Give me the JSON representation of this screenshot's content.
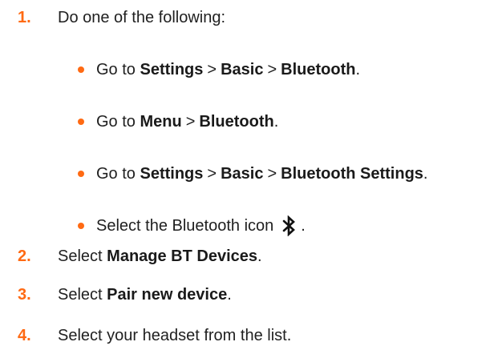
{
  "accent_color": "#ff6a13",
  "steps": [
    {
      "number": "1.",
      "text": "Do one of the following:"
    },
    {
      "number": "2.",
      "prefix": "Select",
      "bold": "Manage BT Devices",
      "suffix": "."
    },
    {
      "number": "3.",
      "prefix": "Select",
      "bold": "Pair new device",
      "suffix": "."
    },
    {
      "number": "4.",
      "text": "Select your headset from the list."
    }
  ],
  "bullets": [
    {
      "prefix": "Go to",
      "path": [
        "Settings",
        "Basic",
        "Bluetooth"
      ],
      "sep": ">",
      "suffix": "."
    },
    {
      "prefix": "Go to",
      "path": [
        "Menu",
        "Bluetooth"
      ],
      "sep": ">",
      "suffix": "."
    },
    {
      "prefix": "Go to",
      "path": [
        "Settings",
        "Basic",
        "Bluetooth Settings"
      ],
      "sep": ">",
      "suffix": "."
    },
    {
      "text": "Select the Bluetooth icon",
      "icon": "bluetooth-icon",
      "suffix": "."
    }
  ]
}
